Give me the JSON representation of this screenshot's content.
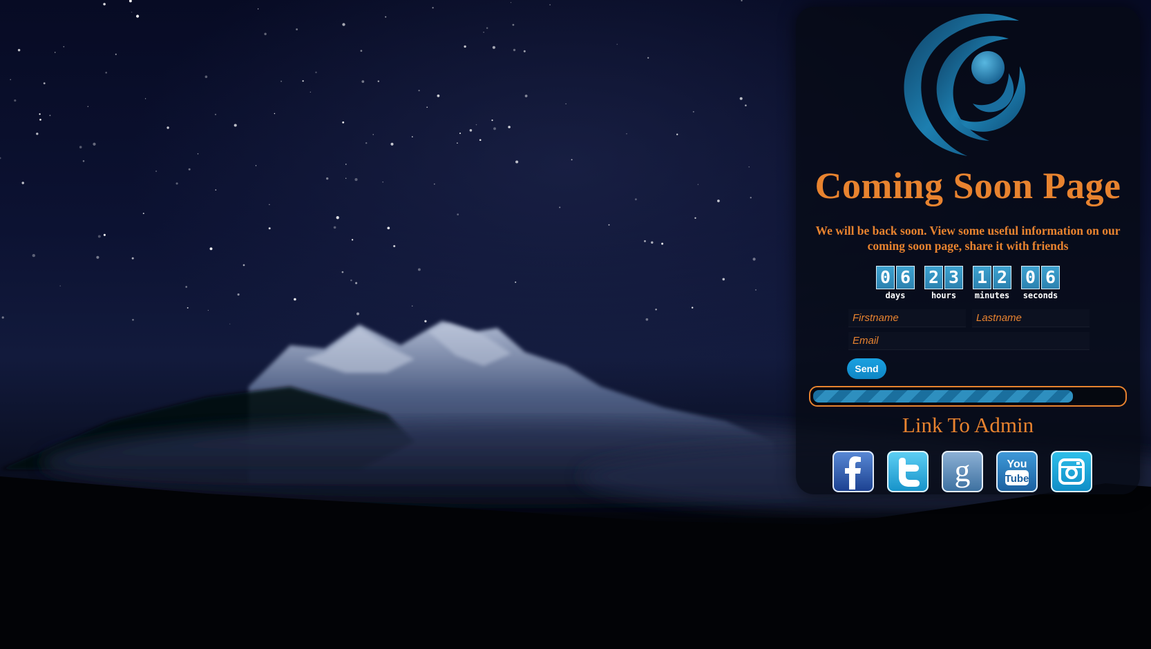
{
  "page": {
    "title": "Coming Soon Page",
    "subtitle": "We will be back soon. View some useful information on our coming soon page, share it with friends"
  },
  "countdown": {
    "days": {
      "digits": [
        "0",
        "6"
      ],
      "label": "days"
    },
    "hours": {
      "digits": [
        "2",
        "3"
      ],
      "label": "hours"
    },
    "minutes": {
      "digits": [
        "1",
        "2"
      ],
      "label": "minutes"
    },
    "seconds": {
      "digits": [
        "0",
        "6"
      ],
      "label": "seconds"
    }
  },
  "form": {
    "firstname_placeholder": "Firstname",
    "lastname_placeholder": "Lastname",
    "email_placeholder": "Email",
    "send_label": "Send"
  },
  "progress": {
    "percent": 84
  },
  "admin_link": "Link To Admin",
  "social": {
    "facebook": {
      "icon": "facebook-icon"
    },
    "twitter": {
      "icon": "twitter-icon"
    },
    "google": {
      "icon": "google-icon"
    },
    "youtube": {
      "icon": "youtube-icon",
      "text_top": "You",
      "text_bottom": "Tube"
    },
    "instagram": {
      "icon": "instagram-icon"
    }
  },
  "colors": {
    "accent": "#e8832f",
    "digit_bg": "#3da2cf",
    "button": "#1aa1e1"
  }
}
